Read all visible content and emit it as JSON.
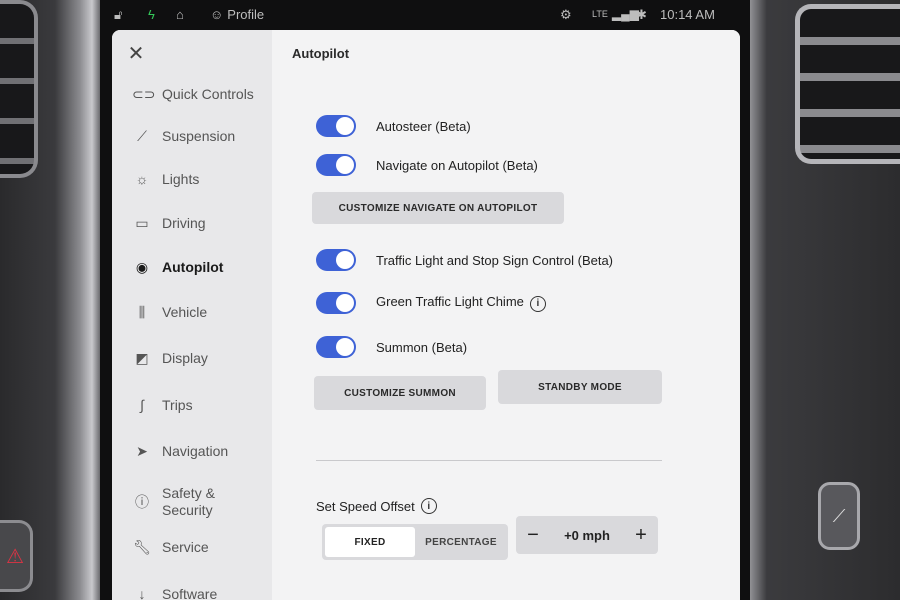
{
  "status_bar": {
    "profile_label": "Profile",
    "network": "LTE",
    "time": "10:14 AM",
    "icons": [
      "lock-icon",
      "bolt-icon",
      "home-icon",
      "person-icon",
      "gear-icon",
      "signal-icon",
      "bluetooth-icon"
    ]
  },
  "sidebar": {
    "close_icon": "close-icon",
    "items": [
      {
        "label": "Quick Controls",
        "icon": "toggle-icon"
      },
      {
        "label": "Suspension",
        "icon": "suspension-icon"
      },
      {
        "label": "Lights",
        "icon": "sun-icon"
      },
      {
        "label": "Driving",
        "icon": "car-icon"
      },
      {
        "label": "Autopilot",
        "icon": "steering-wheel-icon",
        "active": true
      },
      {
        "label": "Vehicle",
        "icon": "sliders-icon"
      },
      {
        "label": "Display",
        "icon": "display-icon"
      },
      {
        "label": "Trips",
        "icon": "trips-icon"
      },
      {
        "label": "Navigation",
        "icon": "navigation-arrow-icon"
      },
      {
        "label": "Safety &",
        "label2": "Security",
        "icon": "alert-icon"
      },
      {
        "label": "Service",
        "icon": "wrench-icon"
      },
      {
        "label": "Software",
        "icon": "download-icon"
      }
    ]
  },
  "main": {
    "title": "Autopilot",
    "toggles": [
      {
        "label": "Autosteer (Beta)",
        "on": true
      },
      {
        "label": "Navigate on Autopilot (Beta)",
        "on": true
      },
      {
        "label": "Traffic Light and Stop Sign Control (Beta)",
        "on": true
      },
      {
        "label": "Green Traffic Light Chime",
        "on": true,
        "info": true
      },
      {
        "label": "Summon (Beta)",
        "on": true
      }
    ],
    "buttons": {
      "customize_nav": "CUSTOMIZE NAVIGATE ON AUTOPILOT",
      "customize_summon": "CUSTOMIZE SUMMON",
      "standby_mode": "STANDBY MODE"
    },
    "speed_offset": {
      "label": "Set Speed Offset",
      "options": [
        "FIXED",
        "PERCENTAGE"
      ],
      "selected": "FIXED",
      "minus": "−",
      "plus": "+",
      "value": "+0 mph"
    }
  },
  "colors": {
    "toggle_on": "#3e62d6",
    "panel_bg": "#f3f3f4",
    "sidebar_bg": "#e8e8ea",
    "button_bg": "#d9d9dc"
  }
}
